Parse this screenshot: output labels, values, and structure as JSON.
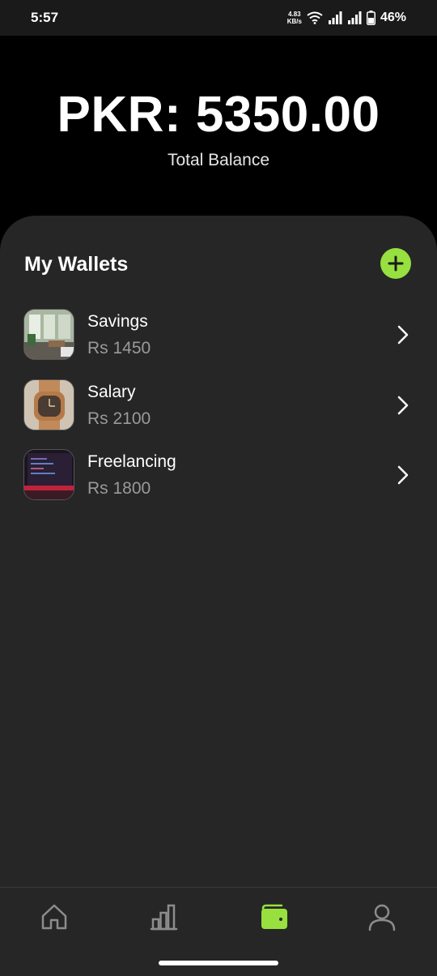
{
  "status_bar": {
    "time": "5:57",
    "net_speed_value": "4.83",
    "net_speed_unit": "KB/s",
    "battery_percent": "46%"
  },
  "header": {
    "balance": "PKR: 5350.00",
    "balance_label": "Total Balance"
  },
  "wallets_panel": {
    "title": "My Wallets",
    "add_icon": "plus-icon",
    "items": [
      {
        "name": "Savings",
        "amount": "Rs 1450",
        "thumbnail": "room-photo"
      },
      {
        "name": "Salary",
        "amount": "Rs 2100",
        "thumbnail": "watch-photo"
      },
      {
        "name": "Freelancing",
        "amount": "Rs 1800",
        "thumbnail": "monitor-photo"
      }
    ]
  },
  "bottom_nav": {
    "items": [
      {
        "icon": "home-icon",
        "active": false
      },
      {
        "icon": "bar-chart-icon",
        "active": false
      },
      {
        "icon": "wallet-icon",
        "active": true
      },
      {
        "icon": "profile-icon",
        "active": false
      }
    ]
  },
  "colors": {
    "accent": "#97e03f",
    "panel_bg": "#262626",
    "header_bg": "#000000",
    "muted_text": "#9a9a9a"
  }
}
